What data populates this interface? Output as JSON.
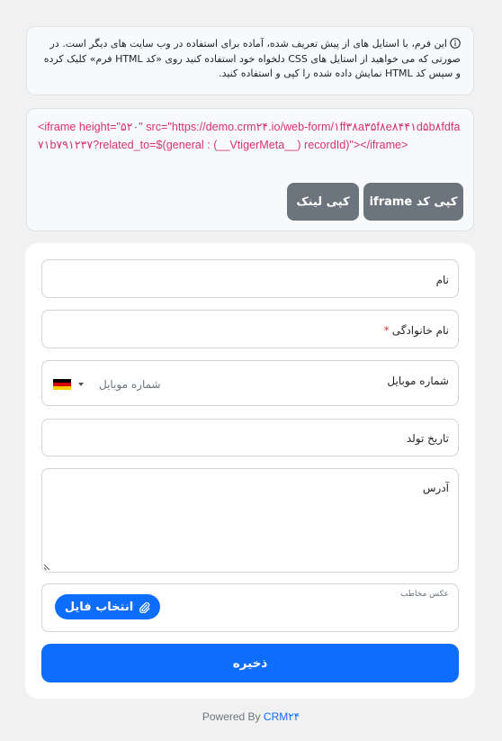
{
  "info": {
    "icon": "info-circle-icon",
    "text": "این فرم، با استایل های از پیش تعریف شده، آماده برای استفاده در وب سایت های دیگر است. در صورتی که می خواهید از استایل های CSS دلخواه خود استفاده کنید روی «کد HTML فرم» کلیک کرده و سپس کد HTML نمایش داده شده را کپی و استفاده کنید."
  },
  "embed": {
    "code": "<iframe height=\"۵۲۰\" src=\"https://demo.crm۲۴.io/web-form/۱ff۳۸a۳۵f۸e۸۴۴۱d۵b۸fdfa۷۱b۷۹۱۲۳۷?related_to=$(general : (__VtigerMeta__) recordId)\"></iframe>",
    "copy_iframe_label": "کپی کد iframe",
    "copy_link_label": "کپی لینک"
  },
  "form": {
    "name_label": "نام",
    "family_label": "نام خانوادگی",
    "required_mark": "*",
    "mobile_label": "شماره موبایل",
    "mobile_placeholder": "شماره موبایل",
    "country_flag": "germany-flag-icon",
    "birth_label": "تاریخ تولد",
    "address_label": "آدرس",
    "photo_label": "عکس مخاطب",
    "file_button_label": "انتخاب فایل",
    "save_label": "ذخیره"
  },
  "footer": {
    "powered_by": "Powered By",
    "brand": "CRM۲۴"
  },
  "colors": {
    "accent": "#0d6efd",
    "code": "#d6336c",
    "button_gray": "#6c757d",
    "required": "#dc3545"
  }
}
